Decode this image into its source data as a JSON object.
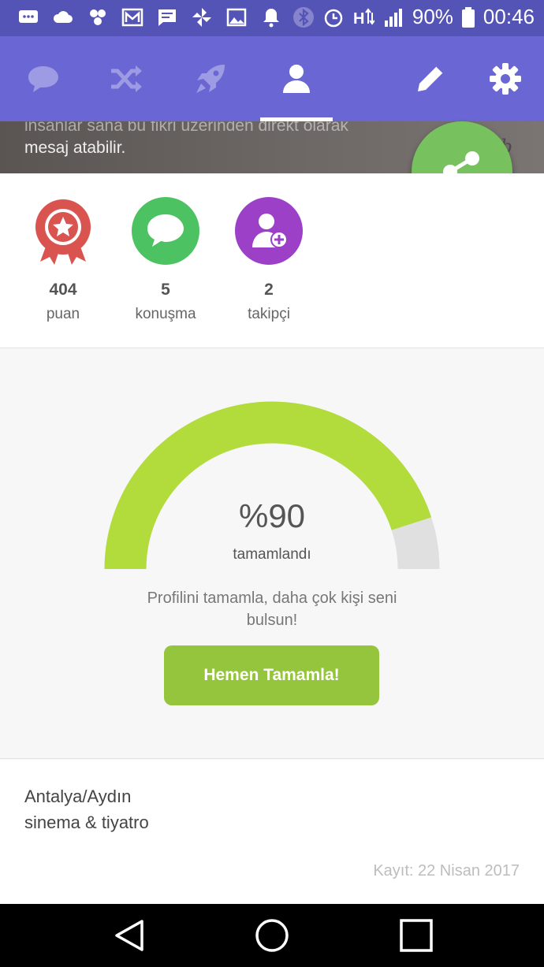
{
  "status_bar": {
    "battery_percent": "90%",
    "time": "00:46",
    "icons": [
      "chat-bubble-icon",
      "cloud-icon",
      "pinwheel-icon",
      "gmail-icon",
      "message-icon",
      "windmill-icon",
      "image-icon",
      "bell-icon",
      "bluetooth-icon",
      "alarm-icon",
      "data-icon",
      "signal-icon",
      "battery-icon"
    ]
  },
  "toolbar": {
    "tabs": [
      "chat-icon",
      "shuffle-icon",
      "rocket-icon",
      "profile-icon"
    ],
    "active_tab": "profile-icon",
    "actions": [
      "edit-icon",
      "settings-icon"
    ]
  },
  "cover": {
    "text_line1": "insanlar sana bu fikri üzerinden direkt olarak",
    "text_line2": "mesaj atabilir.",
    "deco_text": "ab"
  },
  "stats": [
    {
      "value": "404",
      "label": "puan",
      "color": "#d9534f"
    },
    {
      "value": "5",
      "label": "konuşma",
      "color": "#4cc262"
    },
    {
      "value": "2",
      "label": "takipçi",
      "color": "#9b40c7"
    }
  ],
  "gauge": {
    "percent": 90,
    "value_text": "%90",
    "label": "tamamlandı",
    "hint": "Profilini tamamla, daha çok kişi seni bulsun!",
    "button_label": "Hemen Tamamla!",
    "fill_color": "#b2dc3c",
    "track_color": "#e0e0e0"
  },
  "info": {
    "location": "Antalya/Aydın",
    "interest": "sinema & tiyatro",
    "registered": "Kayıt: 22 Nisan 2017"
  },
  "colors": {
    "status_bar": "#5453b6",
    "toolbar": "#6a67d4",
    "share_button": "#77c15e",
    "complete_button": "#95c53c"
  }
}
